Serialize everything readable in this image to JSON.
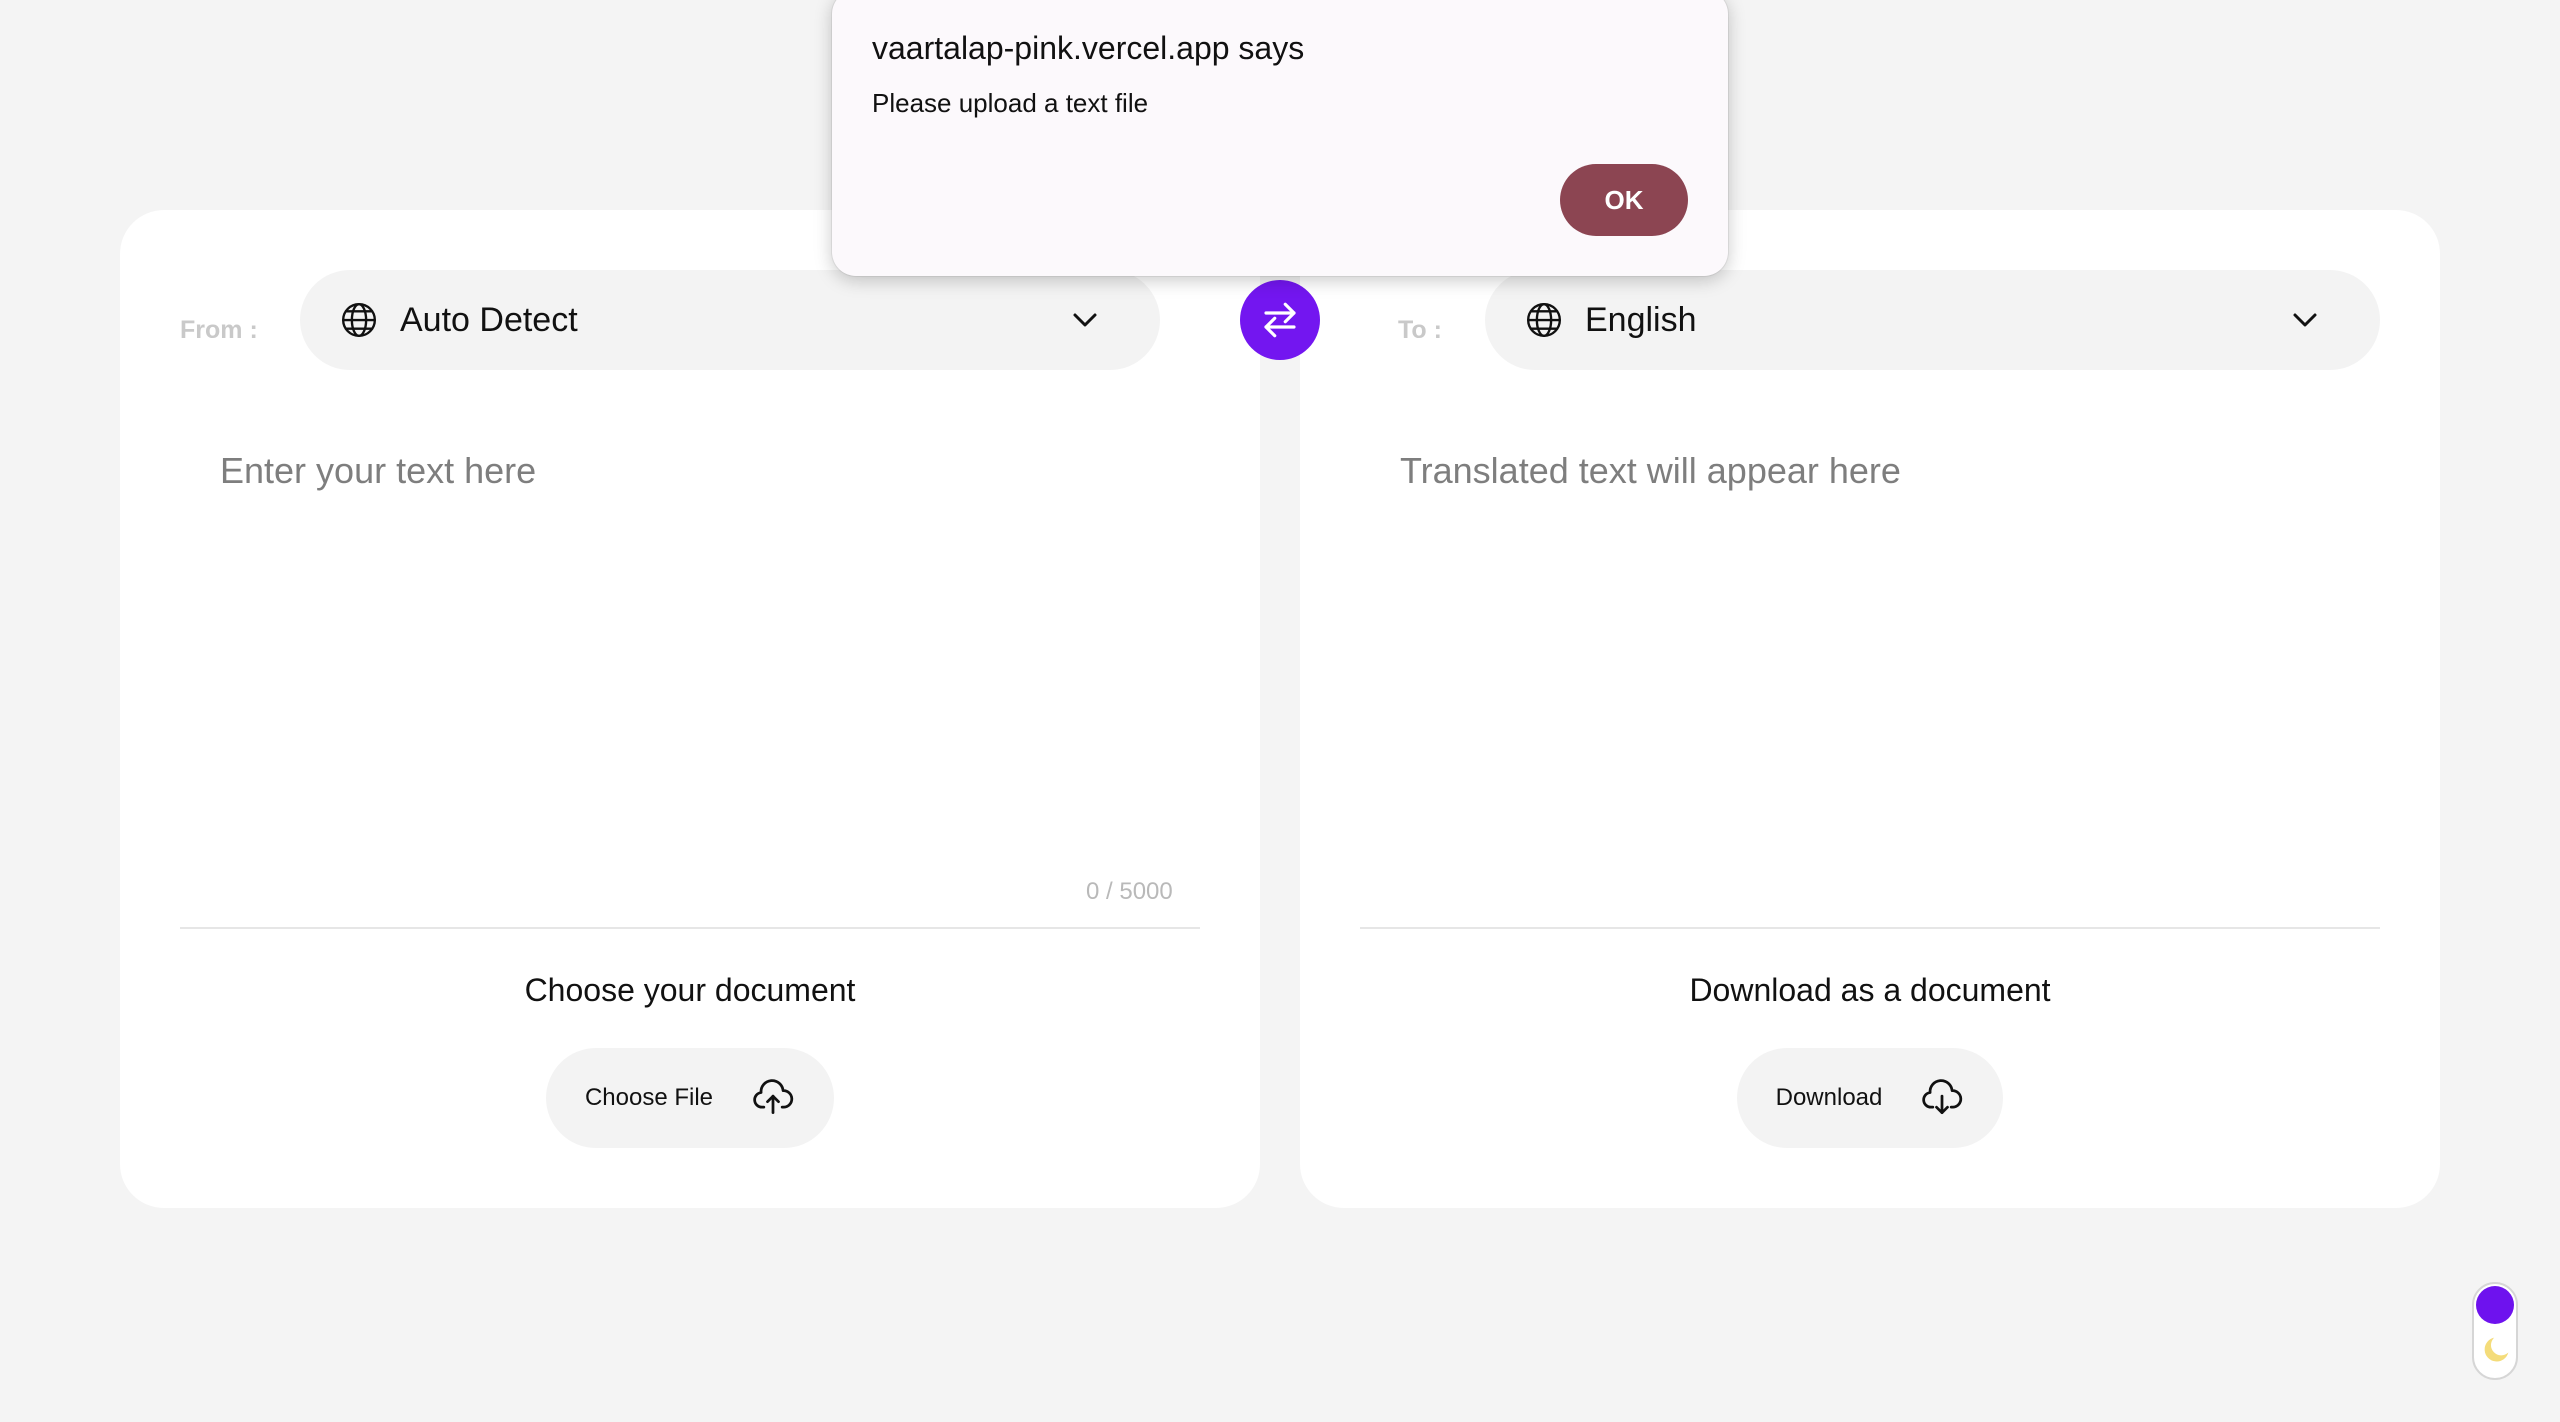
{
  "source": {
    "label": "From :",
    "language": "Auto Detect",
    "placeholder": "Enter your text here",
    "counter": "0 / 5000",
    "doc_title": "Choose your document",
    "doc_button": "Choose File"
  },
  "target": {
    "label": "To :",
    "language": "English",
    "placeholder": "Translated text will appear here",
    "doc_title": "Download as a document",
    "doc_button": "Download"
  },
  "dialog": {
    "title": "vaartalap-pink.vercel.app says",
    "message": "Please upload a text file",
    "ok_label": "OK"
  },
  "icons": {
    "globe": "globe-icon",
    "chevron": "chevron-down-icon",
    "swap": "swap-arrows-icon",
    "upload": "cloud-upload-icon",
    "download": "cloud-download-icon",
    "moon": "moon-icon"
  },
  "colors": {
    "accent": "#7316f0",
    "dialog_ok": "#8c4552",
    "background": "#f4f4f4"
  }
}
